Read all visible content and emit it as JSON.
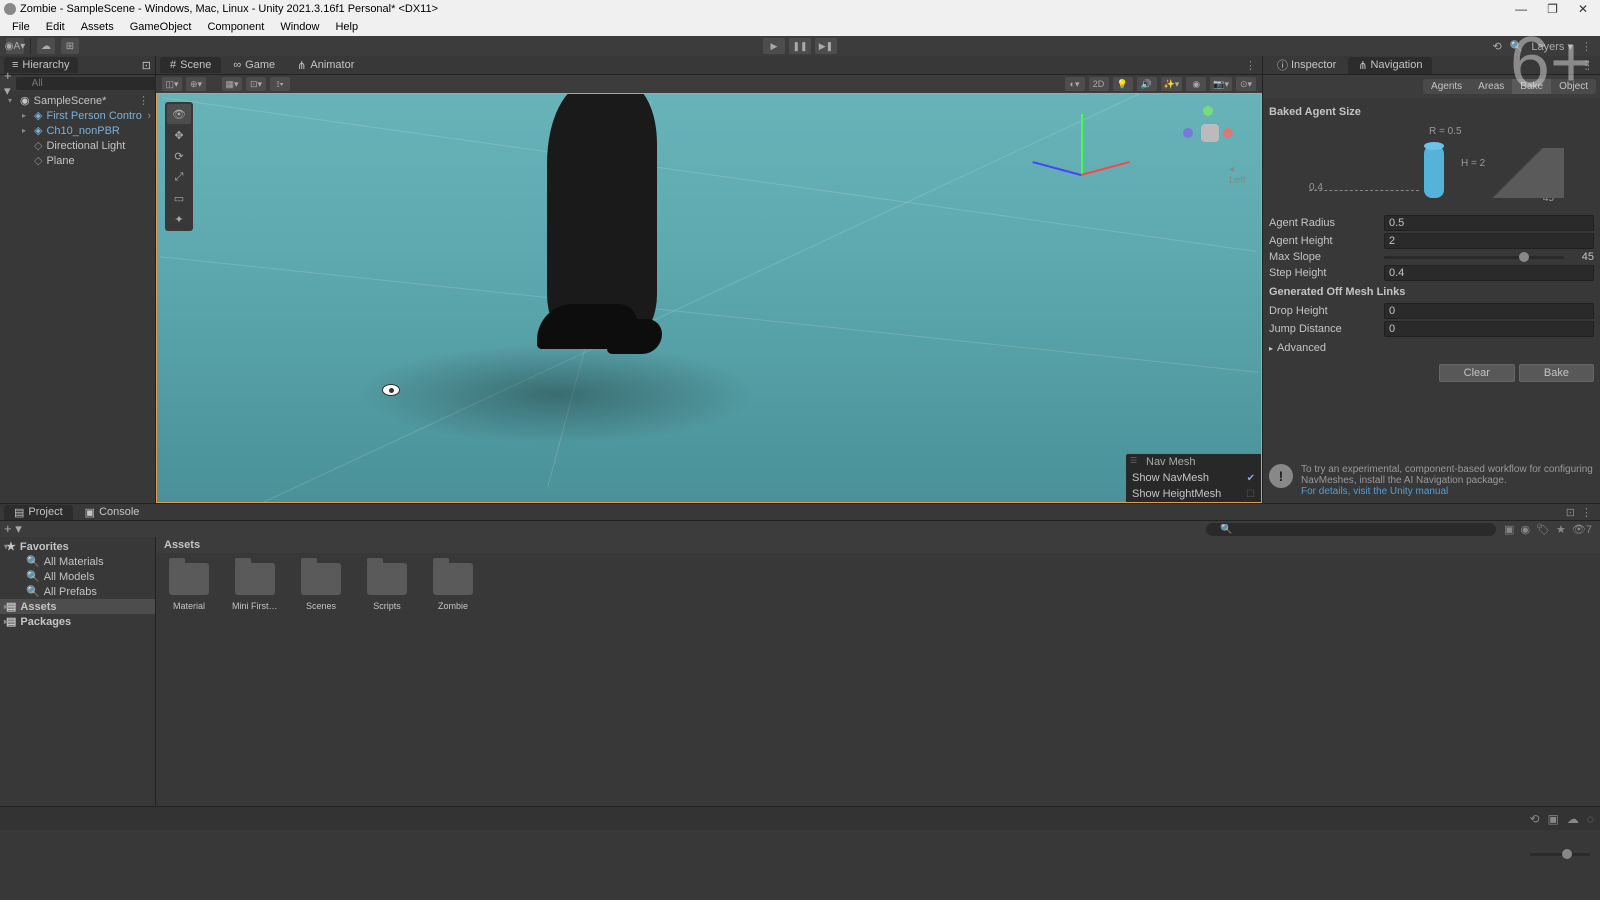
{
  "window": {
    "title": "Zombie - SampleScene - Windows, Mac, Linux - Unity 2021.3.16f1 Personal* <DX11>"
  },
  "menu": [
    "File",
    "Edit",
    "Assets",
    "GameObject",
    "Component",
    "Window",
    "Help"
  ],
  "toolbar": {
    "account_label": "A",
    "layers_label": "Layers"
  },
  "watermark": "6+",
  "hierarchy": {
    "title": "Hierarchy",
    "search_placeholder": "All",
    "scene": "SampleScene*",
    "items": [
      {
        "name": "First Person Contro",
        "prefab": true,
        "expandable": true
      },
      {
        "name": "Ch10_nonPBR",
        "prefab": true,
        "expandable": true
      },
      {
        "name": "Directional Light",
        "prefab": false,
        "expandable": false
      },
      {
        "name": "Plane",
        "prefab": false,
        "expandable": false
      }
    ]
  },
  "scene_tabs": {
    "scene": "Scene",
    "game": "Game",
    "animator": "Animator"
  },
  "scene_toolbar": {
    "mode_2d": "2D"
  },
  "scene_gizmo": {
    "label": "Left"
  },
  "navmesh_overlay": {
    "title": "Nav Mesh",
    "show_navmesh": "Show NavMesh",
    "show_heightmesh": "Show HeightMesh"
  },
  "inspector": {
    "inspector_tab": "Inspector",
    "navigation_tab": "Navigation",
    "subtabs": {
      "agents": "Agents",
      "areas": "Areas",
      "bake": "Bake",
      "object": "Object"
    },
    "baked_agent_size": "Baked Agent Size",
    "diagram": {
      "r_label": "R = 0.5",
      "h_label": "H = 2",
      "step_label": "0.4",
      "slope_label": "45°"
    },
    "agent_radius": {
      "label": "Agent Radius",
      "value": "0.5"
    },
    "agent_height": {
      "label": "Agent Height",
      "value": "2"
    },
    "max_slope": {
      "label": "Max Slope",
      "value": "45"
    },
    "step_height": {
      "label": "Step Height",
      "value": "0.4"
    },
    "offmesh_header": "Generated Off Mesh Links",
    "drop_height": {
      "label": "Drop Height",
      "value": "0"
    },
    "jump_distance": {
      "label": "Jump Distance",
      "value": "0"
    },
    "advanced": "Advanced",
    "clear": "Clear",
    "bake": "Bake",
    "info": "To try an experimental, component-based workflow for configuring NavMeshes, install the AI Navigation package.",
    "info_link": "For details, visit the Unity manual"
  },
  "project": {
    "project_tab": "Project",
    "console_tab": "Console",
    "favorites": "Favorites",
    "fav_items": [
      "All Materials",
      "All Models",
      "All Prefabs"
    ],
    "assets": "Assets",
    "packages": "Packages",
    "breadcrumb": "Assets",
    "folders": [
      "Material",
      "Mini First P...",
      "Scenes",
      "Scripts",
      "Zombie"
    ],
    "hidden_badge": "7"
  }
}
